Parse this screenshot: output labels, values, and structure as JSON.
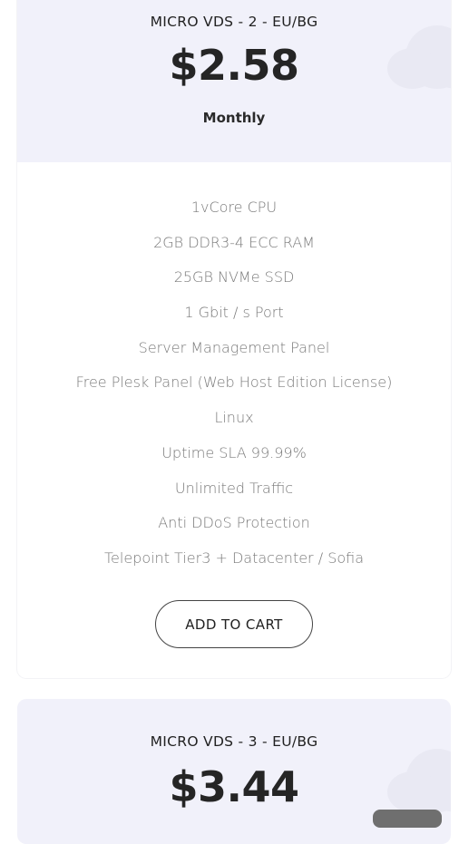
{
  "plans": [
    {
      "name": "MICRO VDS - 2 - EU/BG",
      "price": "$2.58",
      "period": "Monthly",
      "features": [
        "1vCore CPU",
        "2GB DDR3-4 ECC RAM",
        "25GB NVMe SSD",
        "1 Gbit / s Port",
        "Server Management Panel",
        "Free Plesk Panel (Web Host Edition License)",
        "Linux",
        "Uptime SLA 99.99%",
        "Unlimited Traffic",
        "Anti DDoS Protection",
        "Telepoint Tier3 + Datacenter / Sofia"
      ],
      "button_label": "ADD TO CART"
    },
    {
      "name": "MICRO VDS - 3 - EU/BG",
      "price": "$3.44"
    }
  ],
  "colors": {
    "header_bg": "#f1f1fa",
    "text_dark": "#222222",
    "text_muted": "#7a7a7a"
  }
}
